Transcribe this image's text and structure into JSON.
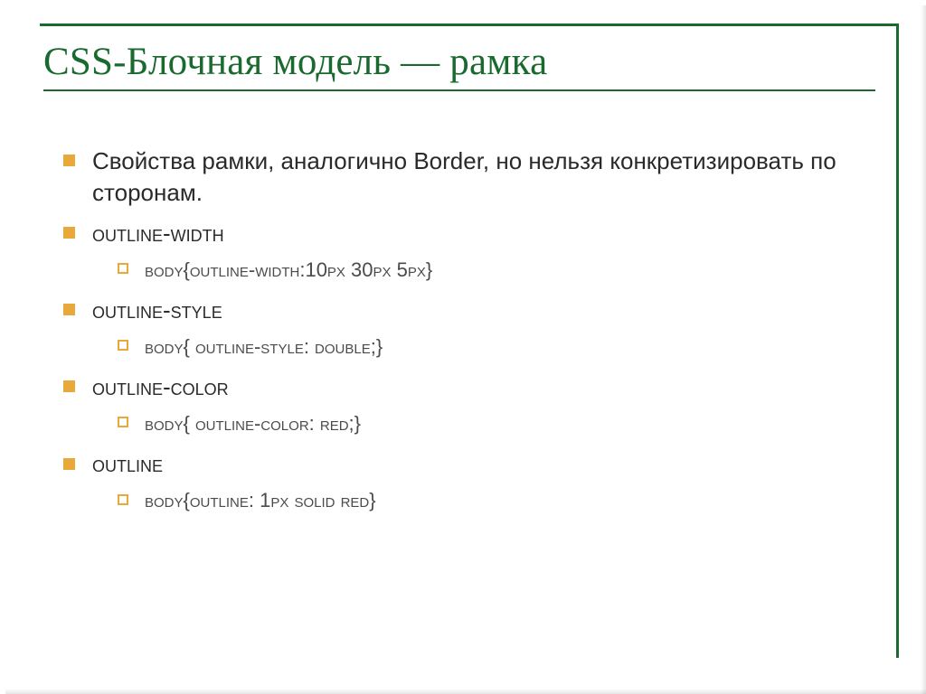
{
  "title": "CSS-Блочная модель — рамка",
  "bullets": {
    "b1": "Свойства рамки, аналогично Border, но нельзя конкретизировать по сторонам.",
    "b2": "Outline-width",
    "b2s1": "Body{outline-width:10px 30px 5px}",
    "b3": "Outline-style",
    "b3s1": "Body{ outline-style: double;}",
    "b4": "Outline-color",
    "b4s1": "Body{ outline-color: red;}",
    "b5": "Outline",
    "b5s1": "Body{outline: 1px solid red}"
  },
  "colors": {
    "accent": "#1a6a2f",
    "bullet": "#e8a93a"
  }
}
